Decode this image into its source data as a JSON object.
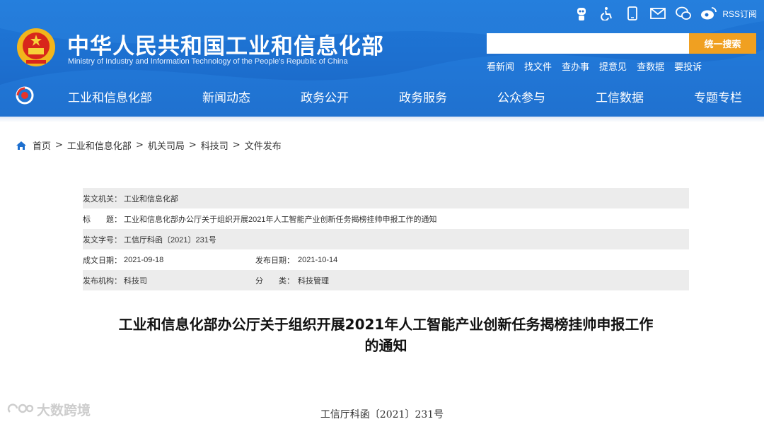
{
  "header": {
    "title": "中华人民共和国工业和信息化部",
    "subtitle": "Ministry of Industry and Information Technology of the People's Republic of China",
    "top_icons": [
      "robot-icon",
      "accessibility-icon",
      "mobile-icon",
      "mail-icon",
      "wechat-icon",
      "weibo-icon"
    ],
    "rss_label": "RSS订阅",
    "search_button": "统一搜索",
    "search_value": "",
    "quick_links": [
      "看新闻",
      "找文件",
      "查办事",
      "提意见",
      "查数据",
      "要投诉"
    ],
    "nav": [
      "工业和信息化部",
      "新闻动态",
      "政务公开",
      "政务服务",
      "公众参与",
      "工信数据",
      "专题专栏"
    ],
    "accent": "#f0a021",
    "brand": "#1d6fcf"
  },
  "breadcrumb": [
    "首页",
    "工业和信息化部",
    "机关司局",
    "科技司",
    "文件发布"
  ],
  "meta": {
    "issuer_label": "发文机关：",
    "issuer": "工业和信息化部",
    "title_label": "标　　题：",
    "title": "工业和信息化部办公厅关于组织开展2021年人工智能产业创新任务揭榜挂帅申报工作的通知",
    "docno_label": "发文字号：",
    "docno": "工信厅科函〔2021〕231号",
    "created_label": "成文日期：",
    "created": "2021-09-18",
    "published_label": "发布日期：",
    "published": "2021-10-14",
    "org_label": "发布机构：",
    "org": "科技司",
    "category_label": "分　　类：",
    "category": "科技管理"
  },
  "article": {
    "title_line1": "工业和信息化部办公厅关于组织开展2021年人工智能产业创新任务揭榜挂帅申报工作",
    "title_line2": "的通知",
    "doc_number": "工信厅科函〔2021〕231号"
  },
  "watermark": "大数跨境"
}
